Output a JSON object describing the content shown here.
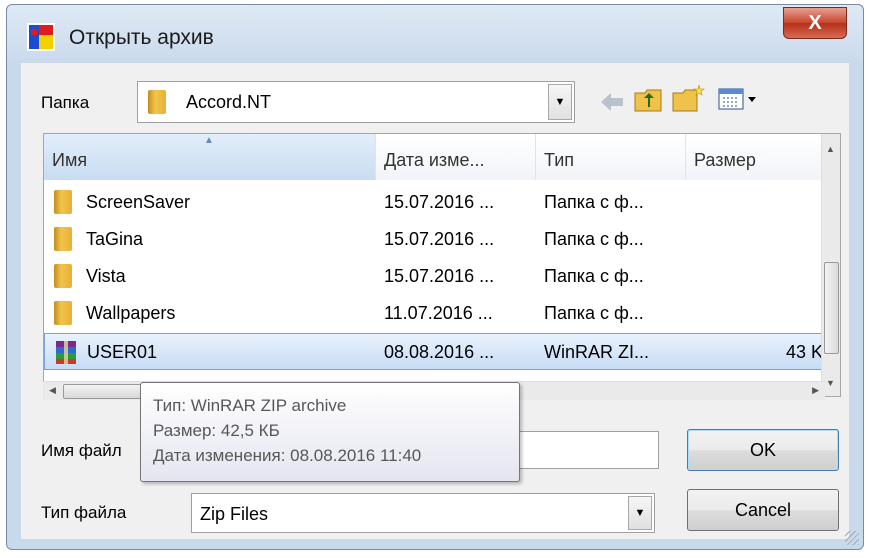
{
  "window": {
    "title": "Открыть архив",
    "close_label": "X"
  },
  "folder": {
    "label": "Папка",
    "value": "Accord.NT"
  },
  "columns": [
    "Имя",
    "Дата изме...",
    "Тип",
    "Размер"
  ],
  "rows": [
    {
      "name": "ScreenSaver",
      "date": "15.07.2016 ...",
      "type": "Папка с ф...",
      "size": ""
    },
    {
      "name": "TaGina",
      "date": "15.07.2016 ...",
      "type": "Папка с ф...",
      "size": ""
    },
    {
      "name": "Vista",
      "date": "15.07.2016 ...",
      "type": "Папка с ф...",
      "size": ""
    },
    {
      "name": "Wallpapers",
      "date": "11.07.2016 ...",
      "type": "Папка с ф...",
      "size": ""
    },
    {
      "name": "USER01",
      "date": "08.08.2016 ...",
      "type": "WinRAR ZI...",
      "size": "43 K"
    }
  ],
  "filename": {
    "label": "Имя файл",
    "value": ""
  },
  "filetype": {
    "label": "Тип файла",
    "value": "Zip Files"
  },
  "buttons": {
    "ok": "OK",
    "cancel": "Cancel"
  },
  "tooltip": {
    "line1": "Тип: WinRAR ZIP archive",
    "line2": "Размер: 42,5 КБ",
    "line3": "Дата изменения: 08.08.2016 11:40"
  },
  "icons": [
    "app-icon",
    "back-icon",
    "up-folder-icon",
    "new-folder-icon",
    "view-menu-icon",
    "folder-icon",
    "winrar-archive-icon"
  ]
}
